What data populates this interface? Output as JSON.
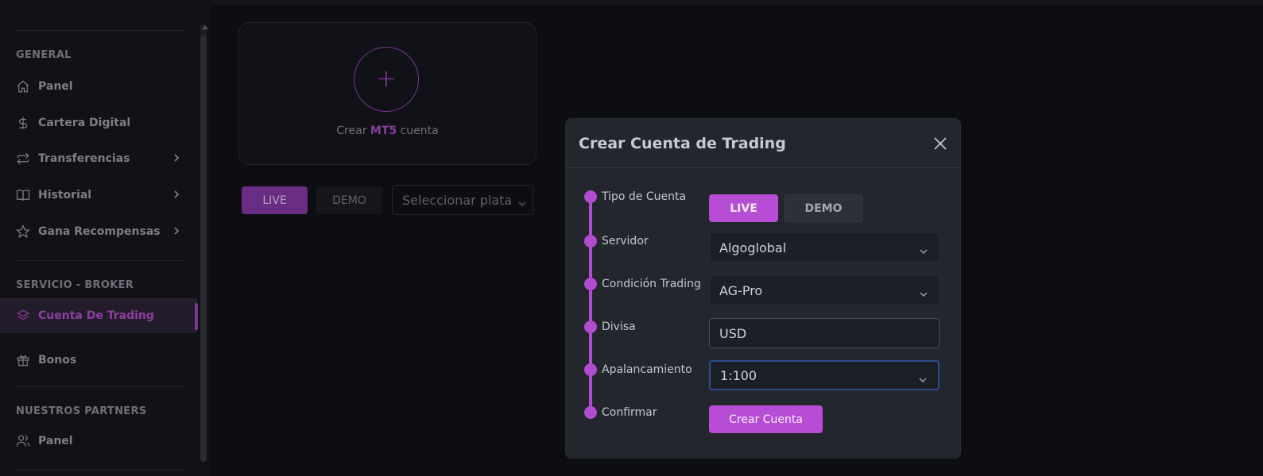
{
  "sidebar": {
    "sections": {
      "general": "GENERAL",
      "broker": "SERVICIO - BROKER",
      "partners": "NUESTROS PARTNERS"
    },
    "items": {
      "panel": "Panel",
      "wallet": "Cartera Digital",
      "transfers": "Transferencias",
      "history": "Historial",
      "rewards": "Gana Recompensas",
      "trading_account": "Cuenta De Trading",
      "bonus": "Bonos",
      "partners_panel": "Panel"
    }
  },
  "main": {
    "create_card": {
      "prefix": "Crear ",
      "highlight": "MT5",
      "suffix": " cuenta",
      "plus": "+"
    },
    "filter": {
      "live": "LIVE",
      "demo": "DEMO",
      "platform_placeholder": "Seleccionar plata"
    }
  },
  "modal": {
    "title": "Crear Cuenta de Trading",
    "steps": {
      "account_type": "Tipo de Cuenta",
      "server": "Servidor",
      "condition": "Condición Trading",
      "currency": "Divisa",
      "leverage": "Apalancamiento",
      "confirm": "Confirmar"
    },
    "account_type_live": "LIVE",
    "account_type_demo": "DEMO",
    "server_value": "Algoglobal",
    "condition_value": "AG-Pro",
    "currency_value": "USD",
    "leverage_value": "1:100",
    "create_button": "Crear Cuenta"
  },
  "colors": {
    "accent": "#b64dd4",
    "background": "#0d0e12",
    "modal": "#24262e"
  }
}
